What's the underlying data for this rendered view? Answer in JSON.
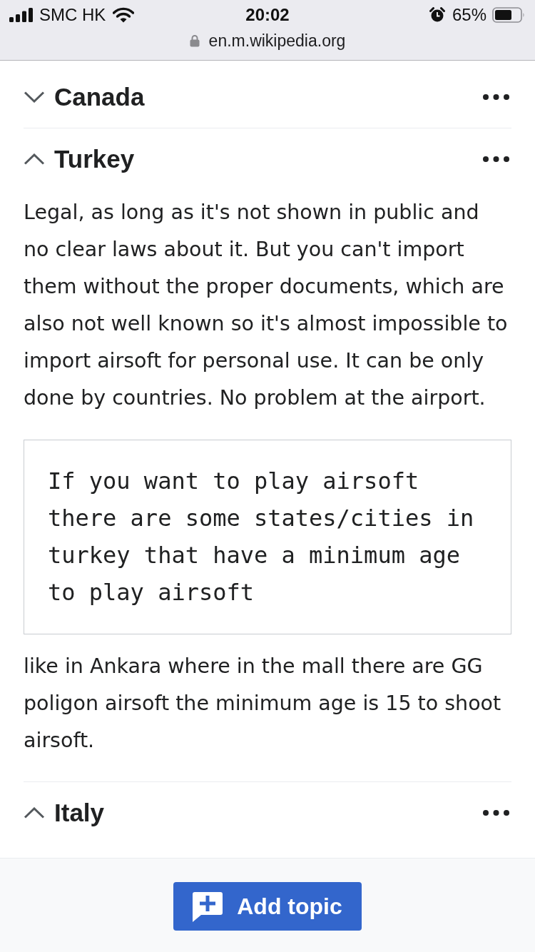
{
  "status_bar": {
    "carrier": "SMC HK",
    "time": "20:02",
    "battery": "65%"
  },
  "address_bar": {
    "url": "en.m.wikipedia.org",
    "secure": true
  },
  "sections": [
    {
      "title": "Canada",
      "expanded": false
    },
    {
      "title": "Turkey",
      "expanded": true,
      "blocks": [
        {
          "kind": "paragraph",
          "text": "Legal, as long as it's not shown in public and no clear laws about it. But you can't import them without the proper documents, which are also not well known so it's almost impossible to import airsoft for personal use. It can be only done by countries. No problem at the airport."
        },
        {
          "kind": "preformatted",
          "text": "If you want to play airsoft there are some states/cities in turkey that have a minimum age to play airsoft"
        },
        {
          "kind": "paragraph",
          "text": "like in Ankara where in the mall there are GG poligon airsoft the minimum age is 15 to shoot airsoft."
        }
      ]
    },
    {
      "title": "Italy",
      "expanded": true
    }
  ],
  "footer": {
    "button": "Add topic"
  }
}
